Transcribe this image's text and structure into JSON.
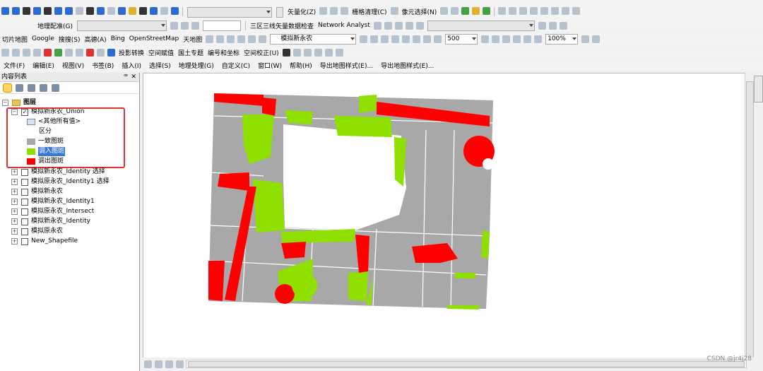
{
  "toolbar1": {
    "vectorize": "矢量化(Z)",
    "raster_clean": "栅格清理(C)",
    "pixel_select": "像元选择(N)"
  },
  "toolbar2": {
    "georef": "地理配准(G)",
    "cadastral": "三区三线矢量数据检查",
    "network": "Network Analyst"
  },
  "toolbar3": {
    "tile_map": "切片地图",
    "google": "Google",
    "sogou": "搜搜(S)",
    "gaode": "高德(A)",
    "bing": "Bing",
    "osm": "OpenStreetMap",
    "tianditu": "天地图",
    "layer_select": "模拟新永农",
    "scale": "500",
    "zoom": "100%"
  },
  "toolbar4": {
    "projection": "投影转换",
    "spatial_assign": "空间赋值",
    "land_topic": "国土专题",
    "numbering": "编号和坐标",
    "spatial_correct": "空间校正(U)"
  },
  "menu": [
    "文件(F)",
    "编辑(E)",
    "视图(V)",
    "书签(B)",
    "插入(I)",
    "选择(S)",
    "地理处理(G)",
    "自定义(C)",
    "窗口(W)",
    "帮助(H)",
    "导出地图样式(E)...",
    "导出地图样式(E)..."
  ],
  "toc": {
    "title": "内容列表",
    "pin": "ꟹ",
    "close": "✕",
    "root": "图层",
    "union_layer": "模拟新永农_Union",
    "other_values": "<其他所有值>",
    "field": "区分",
    "legend": [
      "一致图斑",
      "调入图斑",
      "调出图斑"
    ],
    "layers": [
      "模拟新永农_Identity 选择",
      "模拟原永农_Identity1 选择",
      "模拟新永农",
      "模拟新永农_Identity1",
      "模拟原永农_Intersect",
      "模拟新永农_Identity",
      "模拟原永农",
      "New_Shapefile"
    ]
  },
  "colors": {
    "consistent": "#a8a8a8",
    "in": "#8fe000",
    "out": "#ff0000"
  },
  "watermark": "CSDN @jr4j28"
}
